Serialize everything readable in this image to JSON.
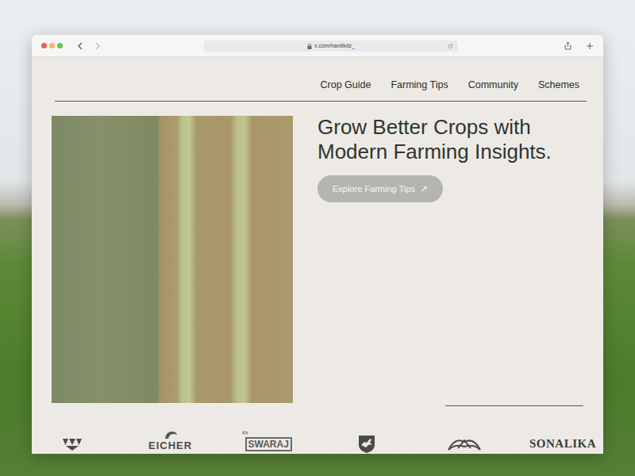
{
  "browser": {
    "url": "x.com/hardikdz_"
  },
  "nav": [
    {
      "label": "Crop Guide"
    },
    {
      "label": "Farming Tips"
    },
    {
      "label": "Community"
    },
    {
      "label": "Schemes"
    }
  ],
  "hero": {
    "heading": "Grow Better Crops with Modern Farming Insights.",
    "button": "Explore Farming Tips",
    "button_icon": "↗"
  },
  "brands": [
    {
      "kind": "mark"
    },
    {
      "kind": "mark-text",
      "label": "EICHER"
    },
    {
      "kind": "tag-text",
      "tag": "मेरा",
      "label": "SWARAJ"
    },
    {
      "kind": "mark"
    },
    {
      "kind": "mark"
    },
    {
      "kind": "text",
      "label": "SONALIKA"
    }
  ]
}
